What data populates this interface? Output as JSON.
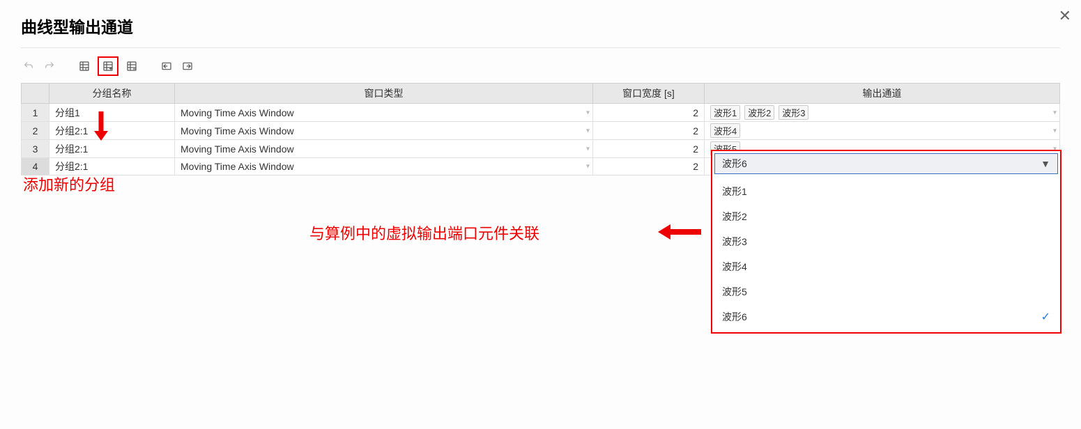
{
  "title": "曲线型输出通道",
  "columns": {
    "name": "分组名称",
    "type": "窗口类型",
    "width": "窗口宽度 [s]",
    "output": "输出通道"
  },
  "rows": [
    {
      "num": "1",
      "name": "分组1",
      "type": "Moving Time Axis Window",
      "width": "2",
      "chips": [
        "波形1",
        "波形2",
        "波形3"
      ]
    },
    {
      "num": "2",
      "name": "分组2:1",
      "type": "Moving Time Axis Window",
      "width": "2",
      "chips": [
        "波形4"
      ]
    },
    {
      "num": "3",
      "name": "分组2:1",
      "type": "Moving Time Axis Window",
      "width": "2",
      "chips": [
        "波形5"
      ]
    },
    {
      "num": "4",
      "name": "分组2:1",
      "type": "Moving Time Axis Window",
      "width": "2",
      "chips": []
    }
  ],
  "dropdown": {
    "selected": "波形6",
    "items": [
      "波形1",
      "波形2",
      "波形3",
      "波形4",
      "波形5",
      "波形6"
    ]
  },
  "annotations": {
    "add_group": "添加新的分组",
    "link_virtual": "与算例中的虚拟输出端口元件关联"
  }
}
